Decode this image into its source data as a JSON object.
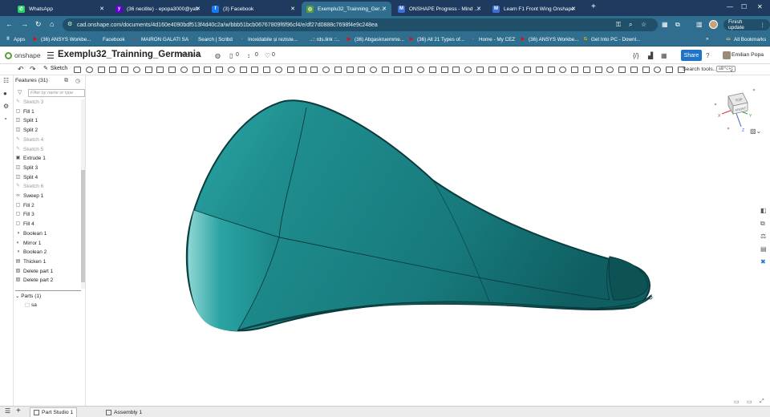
{
  "browser": {
    "tabs": [
      {
        "label": "WhatsApp",
        "icon": "whatsapp-icon",
        "color": "#25d366",
        "glyph": "✆",
        "active": false
      },
      {
        "label": "(36 necitite) - epopa3000@yah",
        "icon": "yahoo-mail-icon",
        "color": "#6001d2",
        "glyph": "y",
        "active": false
      },
      {
        "label": "(3) Facebook",
        "icon": "facebook-icon",
        "color": "#1877f2",
        "glyph": "f",
        "active": false
      },
      {
        "label": "Exemplu32_Trainning_Germania",
        "icon": "onshape-icon",
        "color": "#5a9e3c",
        "glyph": "◎",
        "active": true
      },
      {
        "label": "ONSHAPE Progress - Mind Luci",
        "icon": "mind-icon",
        "color": "#3b6fd6",
        "glyph": "M",
        "active": false
      },
      {
        "label": "Learn F1 Front Wing Onshape",
        "icon": "learn-icon",
        "color": "#3b6fd6",
        "glyph": "M",
        "active": false
      }
    ],
    "new_tab": "+",
    "url": "cad.onshape.com/documents/4d160e4090bdf513f4d40c2a/w/bbb51bcb06767809f6f96cf4/e/df27d0888c7698f4e9c248ea",
    "finish_update": "Finish update",
    "bookmarks": [
      {
        "label": "Apps",
        "icon": "apps-icon",
        "color": "#ffffff",
        "glyph": "⠿"
      },
      {
        "label": "(36) ANSYS Workbe...",
        "icon": "youtube-icon",
        "color": "#ff0000",
        "glyph": "▶"
      },
      {
        "label": "Facebook",
        "icon": "facebook-icon",
        "color": "#1877f2",
        "glyph": "f"
      },
      {
        "label": "MAIRON GALATI SA",
        "icon": "mairon-icon",
        "color": "#c0392b",
        "glyph": "●"
      },
      {
        "label": "Search | Scribd",
        "icon": "scribd-icon",
        "color": "#1e7b85",
        "glyph": "S"
      },
      {
        "label": "Inoxidabile și rezistе...",
        "icon": "inox-icon",
        "color": "#888888",
        "glyph": "▪"
      },
      {
        "label": "..:: rds.link ::..",
        "icon": "rds-icon",
        "color": "#2a7ab8",
        "glyph": "▪"
      },
      {
        "label": "(36) Abgaskruemme...",
        "icon": "youtube-icon",
        "color": "#ff0000",
        "glyph": "▶"
      },
      {
        "label": "(36) All 21 Types of...",
        "icon": "youtube-icon",
        "color": "#ff0000",
        "glyph": "▶"
      },
      {
        "label": "Home - My CEZ",
        "icon": "cez-icon",
        "color": "#f05a28",
        "glyph": "▪"
      },
      {
        "label": "(36) ANSYS Workbe...",
        "icon": "youtube-icon",
        "color": "#ff0000",
        "glyph": "▶"
      },
      {
        "label": "Get Into PC - Downl...",
        "icon": "getintopc-icon",
        "color": "#f2b705",
        "glyph": "G"
      }
    ],
    "all_bookmarks": "All Bookmarks"
  },
  "onshape": {
    "logo": "onshape",
    "doc_title": "Exemplu32_Trainning_Germania",
    "branch": "Main",
    "counts": [
      "0",
      "0",
      "0"
    ],
    "share": "Share",
    "user": "Emilian Popa",
    "help": "?",
    "sketch_label": "Sketch",
    "search_tools": "Search tools...",
    "search_shortcut": "alt/⌥+c"
  },
  "features": {
    "header": "Features (31)",
    "filter_placeholder": "Filter by name or type",
    "items": [
      {
        "label": "Sketch 3",
        "type": "sketch"
      },
      {
        "label": "Fill 1",
        "type": "fill"
      },
      {
        "label": "Split 1",
        "type": "split"
      },
      {
        "label": "Split 2",
        "type": "split"
      },
      {
        "label": "Sketch 4",
        "type": "sketch"
      },
      {
        "label": "Sketch 5",
        "type": "sketch"
      },
      {
        "label": "Extrude 1",
        "type": "extrude"
      },
      {
        "label": "Split 3",
        "type": "split"
      },
      {
        "label": "Split 4",
        "type": "split"
      },
      {
        "label": "Sketch 6",
        "type": "sketch"
      },
      {
        "label": "Sweep 1",
        "type": "sweep"
      },
      {
        "label": "Fill 2",
        "type": "fill"
      },
      {
        "label": "Fill 3",
        "type": "fill"
      },
      {
        "label": "Fill 4",
        "type": "fill"
      },
      {
        "label": "Boolean 1",
        "type": "boolean"
      },
      {
        "label": "Mirror 1",
        "type": "mirror"
      },
      {
        "label": "Boolean 2",
        "type": "boolean"
      },
      {
        "label": "Thicken 1",
        "type": "thicken"
      },
      {
        "label": "Delete part 1",
        "type": "delete"
      },
      {
        "label": "Delete part 2",
        "type": "delete"
      }
    ],
    "parts_header": "Parts (1)",
    "part": "sa"
  },
  "viewcube": {
    "top_label": "TOP",
    "front_label": "FRONT",
    "axis_x": "X",
    "axis_y": "Y",
    "axis_z": "Z"
  },
  "bottom_tabs": [
    {
      "label": "Part Studio 1",
      "active": true
    },
    {
      "label": "Assembly 1",
      "active": false
    }
  ],
  "colors": {
    "part_fill": "#1f8e8e",
    "part_edge": "#0c3c3c",
    "accent": "#2074c8"
  }
}
